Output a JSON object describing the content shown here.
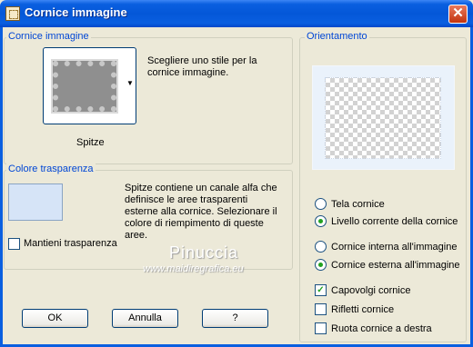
{
  "window": {
    "title": "Cornice immagine",
    "close_glyph": "✕"
  },
  "frame_group": {
    "title": "Cornice immagine",
    "description": "Scegliere uno stile per la cornice immagine.",
    "style_name": "Spitze",
    "dropdown_arrow": "▼"
  },
  "transparency_group": {
    "title": "Colore trasparenza",
    "swatch_color": "#d6e4f7",
    "description": "Spitze contiene un canale alfa che definisce le aree trasparenti esterne alla cornice. Selezionare il colore di riempimento di queste aree.",
    "keep_transparency_label": "Mantieni trasparenza",
    "keep_transparency_checked": false
  },
  "orientation_group": {
    "title": "Orientamento",
    "radio_group_1": [
      {
        "label": "Tela cornice",
        "selected": false
      },
      {
        "label": "Livello corrente della cornice",
        "selected": true
      }
    ],
    "radio_group_2": [
      {
        "label": "Cornice interna all'immagine",
        "selected": false
      },
      {
        "label": "Cornice esterna all'immagine",
        "selected": true
      }
    ],
    "checkboxes": [
      {
        "label": "Capovolgi cornice",
        "checked": true
      },
      {
        "label": "Rifletti cornice",
        "checked": false
      },
      {
        "label": "Ruota cornice a destra",
        "checked": false
      }
    ],
    "check_glyph": "✓"
  },
  "buttons": {
    "ok": "OK",
    "cancel": "Annulla",
    "help": "?"
  },
  "watermark": {
    "name": "Pinuccia",
    "url": "www.maidiregrafica.eu"
  },
  "icons": [
    "app-icon",
    "close-icon",
    "chevron-down-icon"
  ]
}
